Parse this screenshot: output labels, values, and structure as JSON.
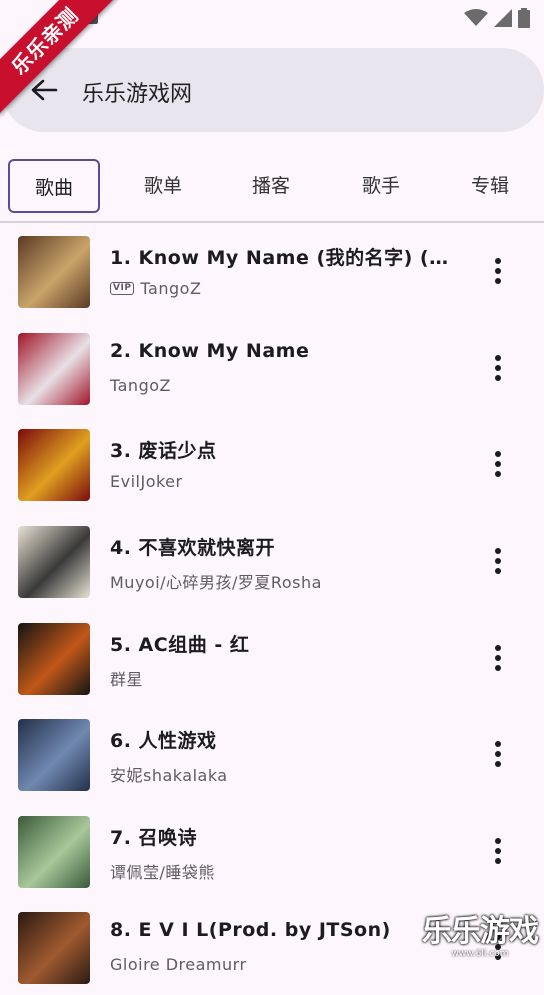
{
  "ribbon": {
    "text": "乐乐亲测"
  },
  "status": {
    "notice_icon": "A"
  },
  "search": {
    "query": "乐乐游戏网"
  },
  "tabs": [
    {
      "label": "歌曲",
      "active": true
    },
    {
      "label": "歌单",
      "active": false
    },
    {
      "label": "播客",
      "active": false
    },
    {
      "label": "歌手",
      "active": false
    },
    {
      "label": "专辑",
      "active": false
    }
  ],
  "songs": [
    {
      "title": "1. Know My Name (我的名字) (L…",
      "artist": "TangoZ",
      "vip": "VIP",
      "cover_colors": [
        "#5a3a24",
        "#c9a46a"
      ]
    },
    {
      "title": "2. Know My Name",
      "artist": "TangoZ",
      "cover_colors": [
        "#a01428",
        "#e8e0e6"
      ]
    },
    {
      "title": "3. 废话少点",
      "artist": "EvilJoker",
      "cover_colors": [
        "#7a0c0c",
        "#e0a020"
      ]
    },
    {
      "title": "4. 不喜欢就快离开",
      "artist": "Muyoi/心碎男孩/罗夏Rosha",
      "cover_colors": [
        "#e8e2d4",
        "#3a3a3a"
      ]
    },
    {
      "title": "5. AC组曲 - 红",
      "artist": "群星",
      "cover_colors": [
        "#141414",
        "#c05818"
      ]
    },
    {
      "title": "6. 人性游戏",
      "artist": "安妮shakalaka",
      "cover_colors": [
        "#22304a",
        "#7088b0"
      ]
    },
    {
      "title": "7. 召唤诗",
      "artist": "谭佩莹/睡袋熊",
      "cover_colors": [
        "#3a5a3a",
        "#a8c89a"
      ]
    },
    {
      "title": "8. E V I L(Prod. by JTSon)",
      "artist": "Gloire Dreamurr",
      "cover_colors": [
        "#2a1a12",
        "#a05a30"
      ]
    }
  ],
  "watermark": {
    "text": "乐乐游戏",
    "url": "www.6ll.com"
  }
}
